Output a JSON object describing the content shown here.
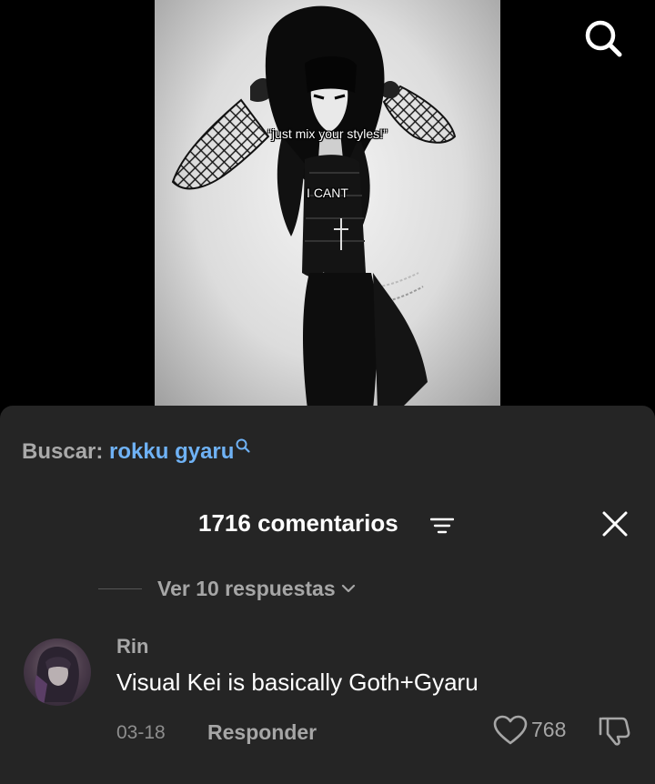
{
  "video": {
    "overlay_line_1": "“just mix your styles!”",
    "overlay_line_2": "I CANT"
  },
  "top_bar": {
    "search_icon": "search-icon"
  },
  "search_suggestion": {
    "label": "Buscar:",
    "query": "rokku gyaru",
    "icon": "search-icon",
    "query_color": "#6fb2f5"
  },
  "comments": {
    "count_label": "1716 comentarios",
    "filter_icon": "filter-icon",
    "close_icon": "close-icon"
  },
  "replies": {
    "label": "Ver 10 respuestas",
    "icon": "chevron-down-icon"
  },
  "comment": {
    "username": "Rin",
    "text": "Visual Kei is basically Goth+Gyaru",
    "date": "03-18",
    "reply_label": "Responder",
    "like_count": "768",
    "like_icon": "heart-icon",
    "dislike_icon": "thumbs-down-icon"
  },
  "colors": {
    "sheet_bg": "#252525",
    "link_blue": "#6fb2f5",
    "muted_text": "#a6a6a6"
  }
}
